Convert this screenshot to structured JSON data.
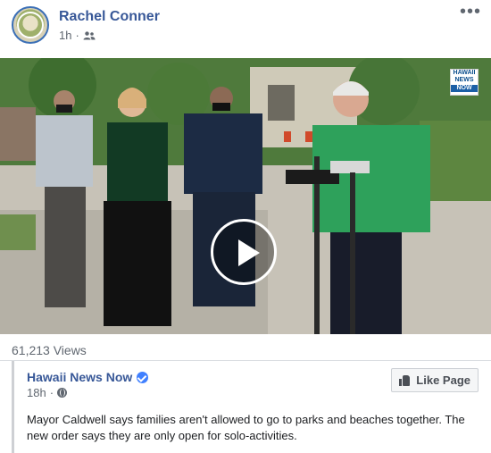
{
  "post": {
    "author": "Rachel Conner",
    "time": "1h",
    "separator": "·",
    "audience_icon": "friends-icon",
    "more_icon": "more-options-icon",
    "more_label": "•••"
  },
  "video": {
    "play_icon": "play-icon",
    "logo_text_top": "HAWAII",
    "logo_text_mid": "NEWS",
    "logo_text_bottom": "NOW"
  },
  "stats": {
    "views": "61,213 Views"
  },
  "shared": {
    "page_name": "Hawaii News Now",
    "verified_icon": "verified-badge-icon",
    "time": "18h",
    "separator": "·",
    "privacy_icon": "globe-icon",
    "like_button": "Like Page",
    "description": "Mayor Caldwell says families aren't allowed to go to parks and beaches together. The new order says they are only open for solo-activities."
  },
  "colors": {
    "link": "#385898",
    "secondary_text": "#606770",
    "verified": "#4080ff",
    "divider": "#dadde1"
  }
}
